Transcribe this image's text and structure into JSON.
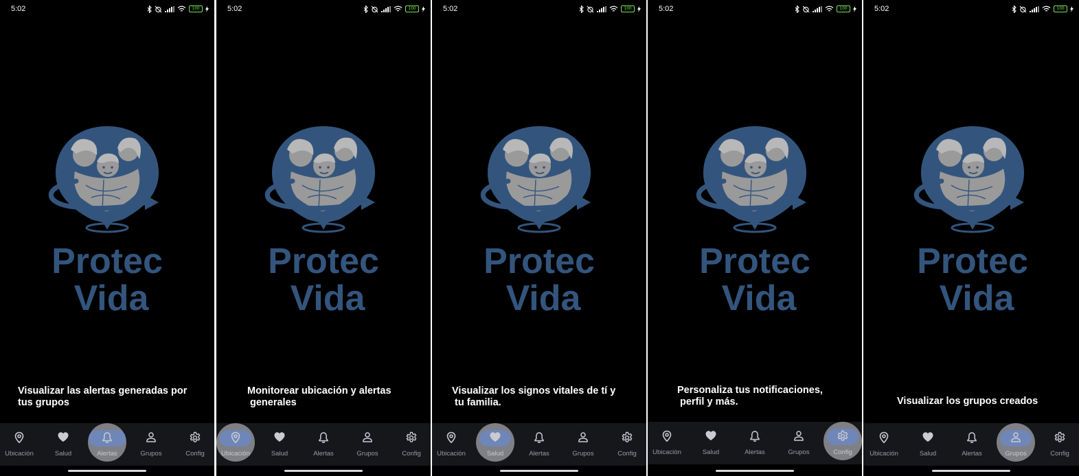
{
  "screens": [
    {
      "time": "5:02",
      "battery": "100",
      "caption_line1": "Visualizar las alertas generadas por",
      "caption_line2": "tus grupos",
      "active": "Alertas"
    },
    {
      "time": "5:02",
      "battery": "100",
      "caption_line1": "Monitorear ubicación y alertas",
      "caption_line2": "generales",
      "active": "Ubicación"
    },
    {
      "time": "5:02",
      "battery": "100",
      "caption_line1": "Visualizar los signos vitales de tí y",
      "caption_line2": "tu familia.",
      "active": "Salud"
    },
    {
      "time": "5:02",
      "battery": "100",
      "caption_line1": "Personaliza tus notificaciones,",
      "caption_line2": "perfil y más.",
      "active": "Config"
    },
    {
      "time": "5:02",
      "battery": "100",
      "caption_line1": "Visualizar los grupos creados",
      "caption_line2": "",
      "active": "Grupos"
    }
  ],
  "logo": {
    "line1": "Protec",
    "line2": "Vida",
    "color": "#33557d",
    "figure_color": "#9a9a9a"
  },
  "nav": [
    {
      "label": "Ubicación",
      "icon": "location-pin-icon"
    },
    {
      "label": "Salud",
      "icon": "heart-icon"
    },
    {
      "label": "Alertas",
      "icon": "bell-icon"
    },
    {
      "label": "Grupos",
      "icon": "person-icon"
    },
    {
      "label": "Config",
      "icon": "gear-icon"
    }
  ],
  "colors": {
    "background": "#000000",
    "nav_background": "#15171b",
    "active_pill": "#6f86b8",
    "highlight_circle": "#7f8085"
  }
}
